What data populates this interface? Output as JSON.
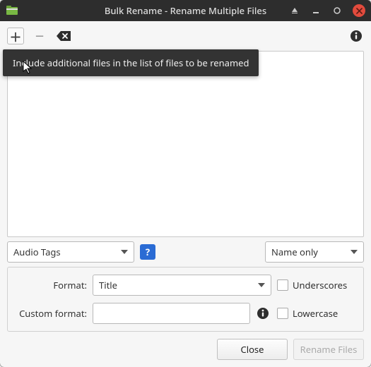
{
  "window": {
    "title": "Bulk Rename - Rename Multiple Files"
  },
  "tooltip": "Include additional files in the list of files to be renamed",
  "selects": {
    "mode": "Audio Tags",
    "column": "Name only"
  },
  "form": {
    "format_label": "Format:",
    "format_value": "Title",
    "custom_label": "Custom format:",
    "custom_value": "",
    "underscores_label": "Underscores",
    "lowercase_label": "Lowercase"
  },
  "footer": {
    "close": "Close",
    "rename": "Rename Files"
  },
  "help": "?"
}
